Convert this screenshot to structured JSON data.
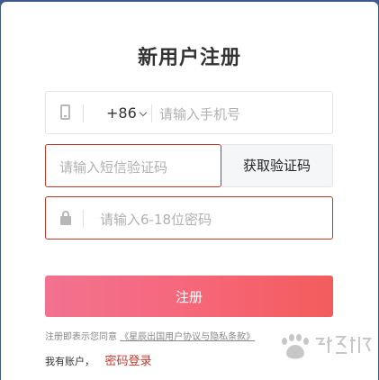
{
  "title": "新用户注册",
  "phone": {
    "country_code": "+86",
    "placeholder": "请输入手机号",
    "icon": "mobile-phone-icon"
  },
  "sms": {
    "placeholder": "请输入短信验证码",
    "button_label": "获取验证码"
  },
  "password": {
    "placeholder": "请输入6-18位密码",
    "icon": "lock-icon"
  },
  "register_button_label": "注册",
  "agreement": {
    "prefix": "注册即表示您同意",
    "link_text": "《星辰出国用户协议与隐私条款》"
  },
  "account": {
    "text": "我有账户，",
    "login_link": "密码登录"
  },
  "watermark_text": "Baidu 经验",
  "colors": {
    "background": "#3d5a8c",
    "error_border": "#c0392b",
    "button_gradient_start": "#f27290",
    "button_gradient_end": "#f45c5c"
  }
}
